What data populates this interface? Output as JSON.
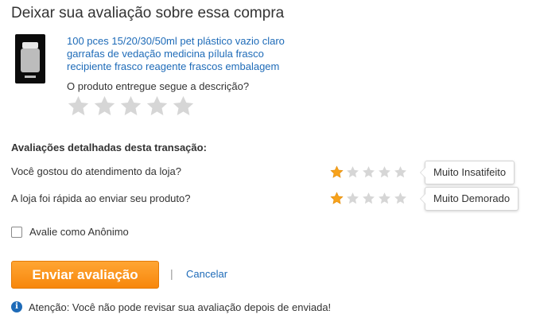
{
  "page": {
    "title": "Deixar sua avaliação sobre essa compra"
  },
  "product": {
    "name": "100 pces 15/20/30/50ml pet plástico vazio claro garrafas de vedação medicina pílula frasco recipiente frasco reagente frascos embalagem",
    "question": "O produto entregue segue a descrição?",
    "rating": 0,
    "max_rating": 5
  },
  "detailed": {
    "title": "Avaliações detalhadas desta transação:",
    "rows": [
      {
        "label": "Você gostou do atendimento da loja?",
        "rating": 1,
        "max": 5,
        "tooltip": "Muito Insatifeito"
      },
      {
        "label": "A loja foi rápida ao enviar seu produto?",
        "rating": 1,
        "max": 5,
        "tooltip": "Muito Demorado"
      }
    ]
  },
  "anonymous": {
    "label": "Avalie como Anônimo",
    "checked": false
  },
  "actions": {
    "submit_label": "Enviar avaliação",
    "separator": "|",
    "cancel_label": "Cancelar"
  },
  "notice": {
    "icon": "info-icon",
    "text": "Atenção: Você não pode revisar sua avaliação depois de enviada!"
  },
  "colors": {
    "star_filled": "#f7a21b",
    "star_empty": "#d6d6d6",
    "accent": "#f7870c",
    "link": "#1e6bb8"
  }
}
